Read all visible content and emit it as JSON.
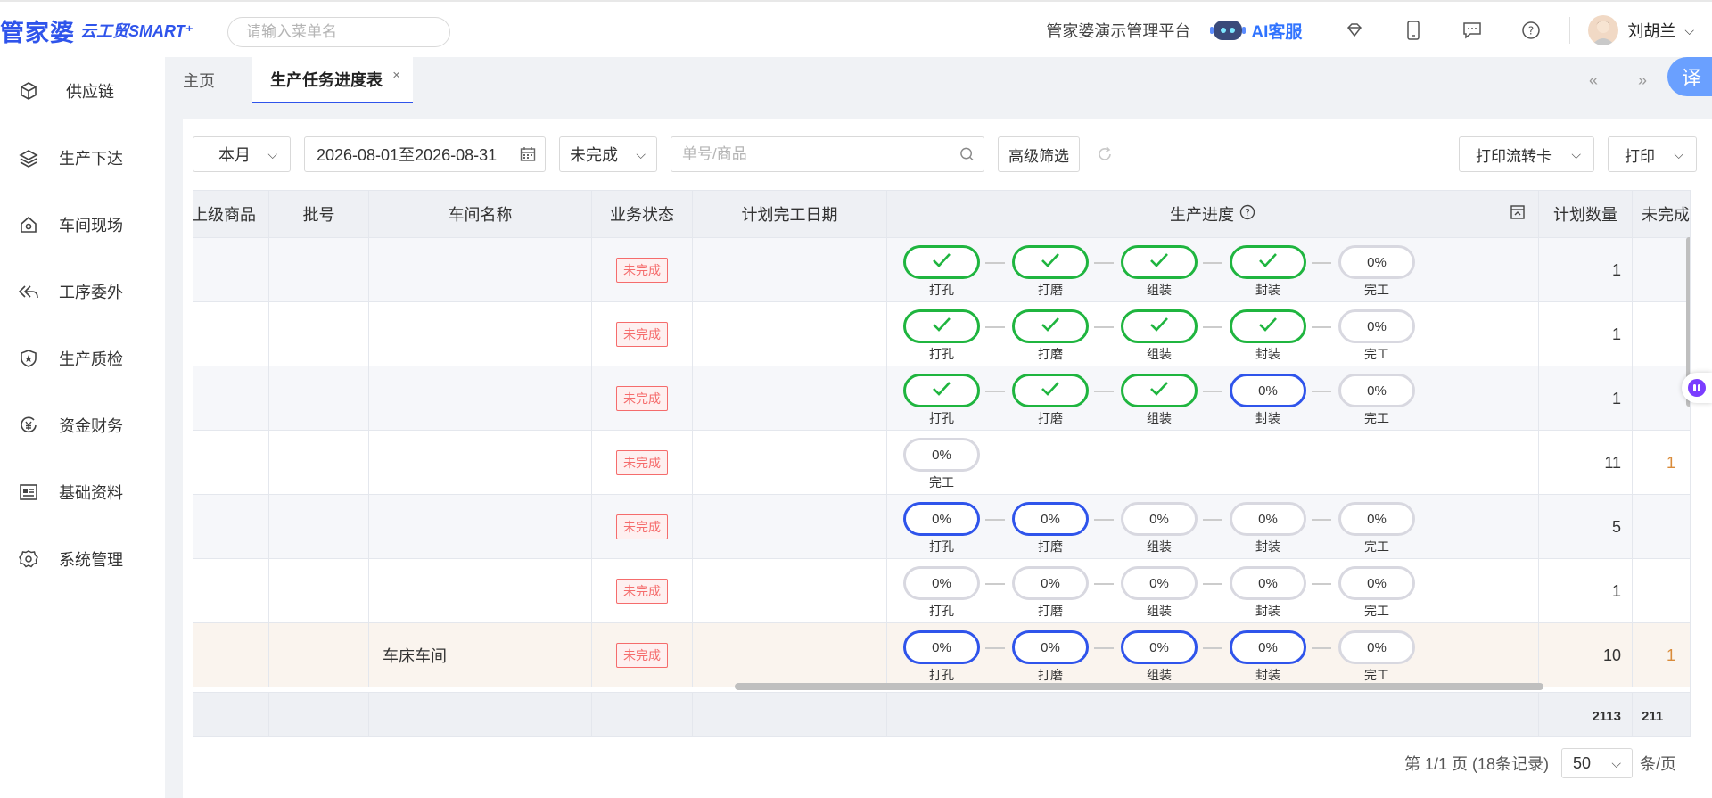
{
  "brand": {
    "logo_main": "管家婆",
    "logo_sub": "云工贸SMART⁺",
    "color": "#2f54eb"
  },
  "topbar": {
    "menu_search_placeholder": "请输入菜单名",
    "platform": "管家婆演示管理平台",
    "ai_label": "AI客服",
    "user_name": "刘胡兰"
  },
  "sidebar": {
    "items": [
      {
        "label": "供应链",
        "icon": "cube-icon"
      },
      {
        "label": "生产下达",
        "icon": "layers-icon"
      },
      {
        "label": "车间现场",
        "icon": "house-icon"
      },
      {
        "label": "工序委外",
        "icon": "reply-all-icon"
      },
      {
        "label": "生产质检",
        "icon": "shield-star-icon"
      },
      {
        "label": "资金财务",
        "icon": "yuan-coin-icon"
      },
      {
        "label": "基础资料",
        "icon": "id-card-icon"
      },
      {
        "label": "系统管理",
        "icon": "gear-icon"
      }
    ]
  },
  "tabs": {
    "home": "主页",
    "active": "生产任务进度表",
    "close": "×",
    "translate": "译"
  },
  "filters": {
    "period": "本月",
    "date_range": "2026-08-01至2026-08-31",
    "status": "未完成",
    "search_placeholder": "单号/商品",
    "advanced": "高级筛选",
    "print_card": "打印流转卡",
    "print": "打印"
  },
  "table": {
    "columns": [
      "上级商品",
      "批号",
      "车间名称",
      "业务状态",
      "计划完工日期",
      "生产进度",
      "计划数量",
      "未完成数"
    ],
    "rows": [
      {
        "workshop": "",
        "status": "未完成",
        "qty": "1",
        "unfinished": "",
        "steps": [
          {
            "label": "打孔",
            "state": "done",
            "pct": ""
          },
          {
            "label": "打磨",
            "state": "done",
            "pct": ""
          },
          {
            "label": "组装",
            "state": "done",
            "pct": ""
          },
          {
            "label": "封装",
            "state": "done",
            "pct": ""
          },
          {
            "label": "完工",
            "state": "idle",
            "pct": "0%"
          }
        ]
      },
      {
        "workshop": "",
        "status": "未完成",
        "qty": "1",
        "unfinished": "",
        "steps": [
          {
            "label": "打孔",
            "state": "done",
            "pct": ""
          },
          {
            "label": "打磨",
            "state": "done",
            "pct": ""
          },
          {
            "label": "组装",
            "state": "done",
            "pct": ""
          },
          {
            "label": "封装",
            "state": "done",
            "pct": ""
          },
          {
            "label": "完工",
            "state": "idle",
            "pct": "0%"
          }
        ]
      },
      {
        "workshop": "",
        "status": "未完成",
        "qty": "1",
        "unfinished": "",
        "steps": [
          {
            "label": "打孔",
            "state": "done",
            "pct": ""
          },
          {
            "label": "打磨",
            "state": "done",
            "pct": ""
          },
          {
            "label": "组装",
            "state": "done",
            "pct": ""
          },
          {
            "label": "封装",
            "state": "active",
            "pct": "0%"
          },
          {
            "label": "完工",
            "state": "idle",
            "pct": "0%"
          }
        ]
      },
      {
        "workshop": "",
        "status": "未完成",
        "qty": "11",
        "unfinished": "1",
        "steps": [
          {
            "label": "完工",
            "state": "idle",
            "pct": "0%"
          }
        ]
      },
      {
        "workshop": "",
        "status": "未完成",
        "qty": "5",
        "unfinished": "",
        "steps": [
          {
            "label": "打孔",
            "state": "active",
            "pct": "0%"
          },
          {
            "label": "打磨",
            "state": "active",
            "pct": "0%"
          },
          {
            "label": "组装",
            "state": "idle",
            "pct": "0%"
          },
          {
            "label": "封装",
            "state": "idle",
            "pct": "0%"
          },
          {
            "label": "完工",
            "state": "idle",
            "pct": "0%"
          }
        ]
      },
      {
        "workshop": "",
        "status": "未完成",
        "qty": "1",
        "unfinished": "",
        "steps": [
          {
            "label": "打孔",
            "state": "idle",
            "pct": "0%"
          },
          {
            "label": "打磨",
            "state": "idle",
            "pct": "0%"
          },
          {
            "label": "组装",
            "state": "idle",
            "pct": "0%"
          },
          {
            "label": "封装",
            "state": "idle",
            "pct": "0%"
          },
          {
            "label": "完工",
            "state": "idle",
            "pct": "0%"
          }
        ]
      },
      {
        "workshop": "车床车间",
        "status": "未完成",
        "qty": "10",
        "unfinished": "1",
        "highlight": true,
        "steps": [
          {
            "label": "打孔",
            "state": "active",
            "pct": "0%"
          },
          {
            "label": "打磨",
            "state": "active",
            "pct": "0%"
          },
          {
            "label": "组装",
            "state": "active",
            "pct": "0%"
          },
          {
            "label": "封装",
            "state": "active",
            "pct": "0%"
          },
          {
            "label": "完工",
            "state": "idle",
            "pct": "0%"
          }
        ]
      }
    ],
    "totals": {
      "qty": "2113",
      "unfinished": "211"
    }
  },
  "pager": {
    "info": "第 1/1 页 (18条记录)",
    "size": "50",
    "unit": "条/页"
  },
  "colors": {
    "done": "#1fb53f",
    "active": "#2f54eb",
    "idle": "#d8d8e0",
    "tag": "#f56c6c"
  }
}
